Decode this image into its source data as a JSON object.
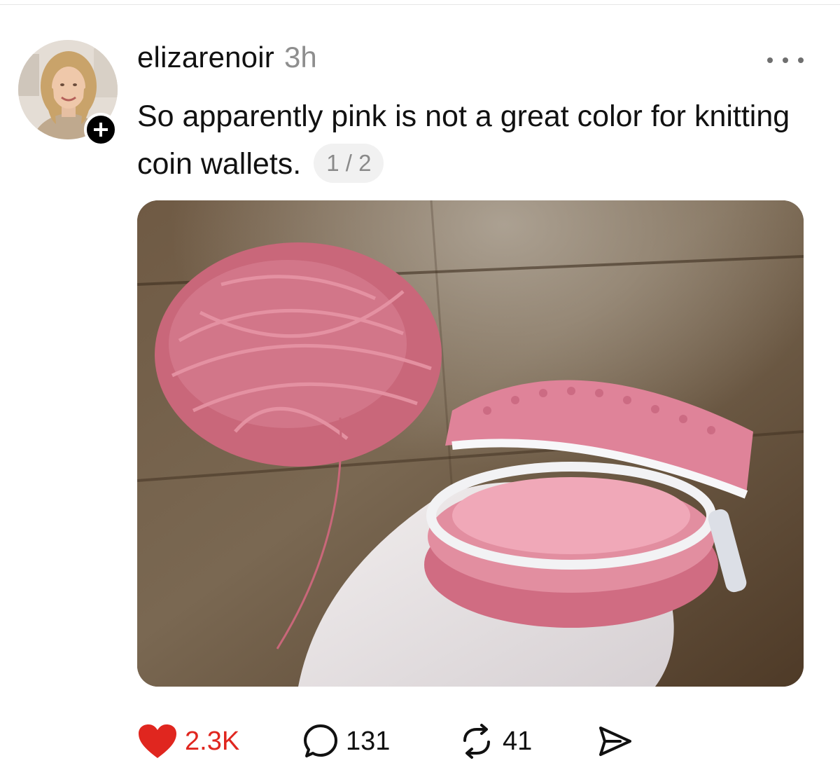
{
  "post": {
    "username": "elizarenoir",
    "timestamp": "3h",
    "caption": "So apparently pink is not a great color for knitting coin wallets.",
    "page_indicator": "1 / 2"
  },
  "actions": {
    "likes": "2.3K",
    "replies": "131",
    "reposts": "41"
  },
  "icons": {
    "avatar": "profile-photo",
    "follow": "plus-icon",
    "more": "more-dots-icon",
    "like": "heart-icon",
    "reply": "speech-bubble-icon",
    "repost": "repost-arrows-icon",
    "share": "send-icon"
  },
  "colors": {
    "like_active": "#e0261f",
    "text": "#111111",
    "muted": "#8e8e8e",
    "pill_bg": "#f1f1f1"
  }
}
